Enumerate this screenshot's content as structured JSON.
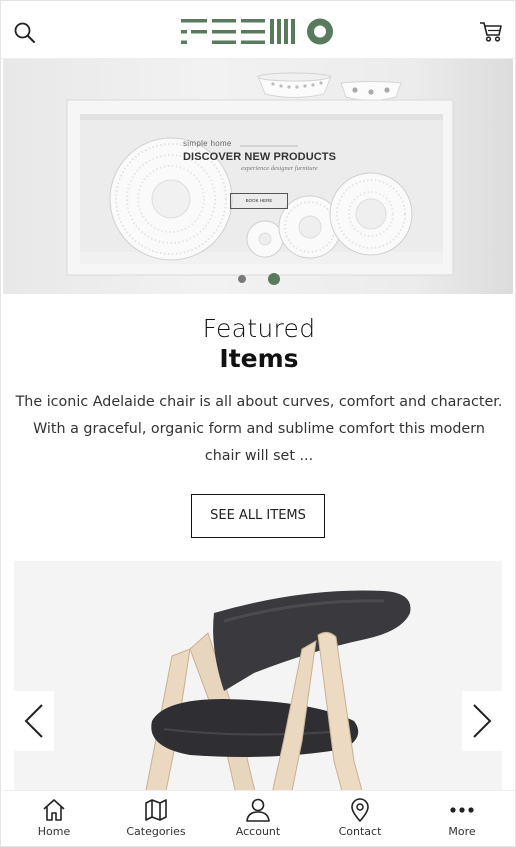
{
  "brand": {
    "logo_text": "FEEMO",
    "accent": "#5a7a5e"
  },
  "header": {
    "search_icon": "search-icon",
    "cart_icon": "cart-icon"
  },
  "hero": {
    "kicker": "simple home",
    "title": "DISCOVER NEW PRODUCTS",
    "subtitle": "experience designer furniture",
    "button": "BOOK HERE",
    "slides": 2,
    "active_slide": 2
  },
  "featured": {
    "title_line1": "Featured",
    "title_line2": "Items",
    "description": "The iconic Adelaide chair is all about curves, comfort and character. With a graceful, organic form and sublime comfort this modern chair will set ...",
    "button": "SEE ALL ITEMS"
  },
  "product_carousel": {
    "prev_icon": "chevron-left-icon",
    "next_icon": "chevron-right-icon"
  },
  "bottom_nav": {
    "items": [
      {
        "label": "Home",
        "icon": "home-icon"
      },
      {
        "label": "Categories",
        "icon": "map-icon"
      },
      {
        "label": "Account",
        "icon": "user-icon"
      },
      {
        "label": "Contact",
        "icon": "location-pin-icon"
      },
      {
        "label": "More",
        "icon": "more-dots-icon"
      }
    ]
  }
}
